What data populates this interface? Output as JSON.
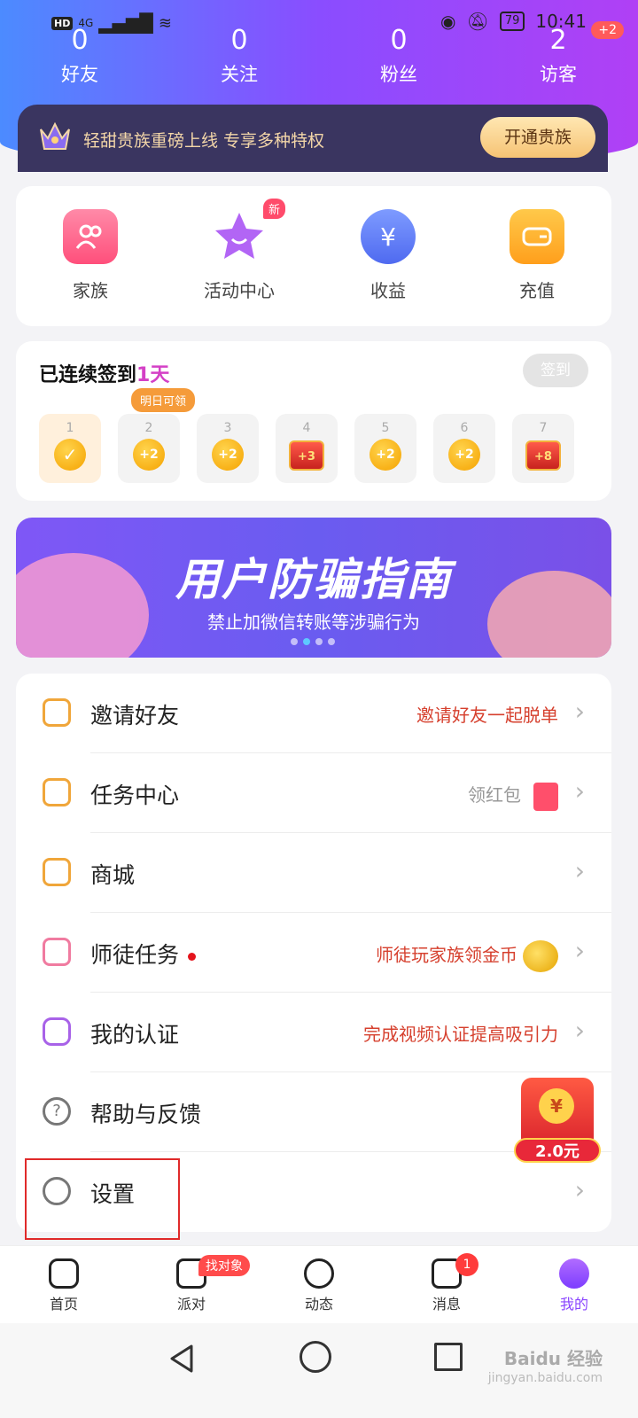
{
  "status_bar": {
    "network": "4G",
    "hd": "HD",
    "battery": "79",
    "time": "10:41"
  },
  "stats": [
    {
      "value": "0",
      "label": "好友"
    },
    {
      "value": "0",
      "label": "关注"
    },
    {
      "value": "0",
      "label": "粉丝"
    },
    {
      "value": "2",
      "label": "访客"
    }
  ],
  "visitor_badge": "+2",
  "vip": {
    "text": "轻甜贵族重磅上线 专享多种特权",
    "button": "开通贵族"
  },
  "quick_actions": [
    {
      "label": "家族",
      "icon": "family-icon",
      "color": "#ff5f8d"
    },
    {
      "label": "活动中心",
      "icon": "star-icon",
      "color": "#b265f5",
      "badge": "新"
    },
    {
      "label": "收益",
      "icon": "money-bag-icon",
      "color": "#5c7cff",
      "glyph": "¥"
    },
    {
      "label": "充值",
      "icon": "wallet-icon",
      "color": "#ffb22f"
    }
  ],
  "checkin": {
    "title_prefix": "已连续签到",
    "days_count": "1天",
    "button": "签到",
    "tip": "明日可领",
    "days": [
      {
        "day": "1",
        "reward": "✓",
        "type": "done"
      },
      {
        "day": "2",
        "reward": "+2",
        "type": "coin"
      },
      {
        "day": "3",
        "reward": "+2",
        "type": "coin"
      },
      {
        "day": "4",
        "reward": "+3",
        "type": "chest"
      },
      {
        "day": "5",
        "reward": "+2",
        "type": "coin"
      },
      {
        "day": "6",
        "reward": "+2",
        "type": "coin"
      },
      {
        "day": "7",
        "reward": "+8",
        "type": "chest"
      }
    ]
  },
  "banner": {
    "title": "用户防骗指南",
    "subtitle": "禁止加微信转账等涉骗行为",
    "active_dot": 1,
    "dot_count": 4
  },
  "menu": [
    {
      "label": "邀请好友",
      "right": "邀请好友一起脱单",
      "right_color": "#d6402e",
      "icon": "invite-icon",
      "icon_color": "#f0a63a"
    },
    {
      "label": "任务中心",
      "right": "领红包",
      "right_color": "#999999",
      "icon": "task-icon",
      "icon_color": "#f0a63a",
      "extra": "redpack"
    },
    {
      "label": "商城",
      "right": "",
      "icon": "shop-icon",
      "icon_color": "#f0a63a"
    },
    {
      "label": "师徒任务",
      "right": "师徒玩家族领金币",
      "right_color": "#d6402e",
      "icon": "mentor-icon",
      "icon_color": "#f07ba0",
      "dot": true,
      "extra": "coins"
    },
    {
      "label": "我的认证",
      "right": "完成视频认证提高吸引力",
      "right_color": "#d6402e",
      "icon": "verify-icon",
      "icon_color": "#a862e8"
    },
    {
      "label": "帮助与反馈",
      "right": "",
      "icon": "help-icon",
      "icon_color": "#777777"
    },
    {
      "label": "设置",
      "right": "",
      "icon": "settings-icon",
      "icon_color": "#777777"
    }
  ],
  "floating_redpack": {
    "coin": "¥",
    "amount": "2.0元"
  },
  "tabbar": [
    {
      "label": "首页",
      "icon": "home-icon"
    },
    {
      "label": "派对",
      "icon": "party-icon",
      "badge": "找对象"
    },
    {
      "label": "动态",
      "icon": "compass-icon"
    },
    {
      "label": "消息",
      "icon": "message-icon",
      "count": "1"
    },
    {
      "label": "我的",
      "icon": "profile-icon",
      "active": true
    }
  ],
  "watermark": {
    "text": "Baidu 经验",
    "sub": "jingyan.baidu.com"
  }
}
